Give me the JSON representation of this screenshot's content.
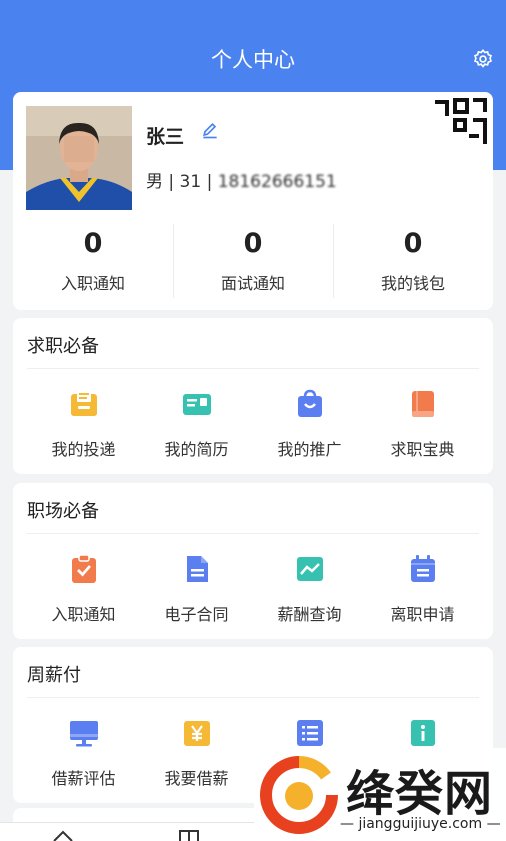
{
  "header": {
    "title": "个人中心",
    "settings_icon": "gear-icon"
  },
  "profile": {
    "name": "张三",
    "gender": "男",
    "age": "31",
    "phone": "18162666151",
    "stats": [
      {
        "value": "0",
        "label": "入职通知"
      },
      {
        "value": "0",
        "label": "面试通知"
      },
      {
        "value": "0",
        "label": "我的钱包"
      }
    ]
  },
  "sections": [
    {
      "title": "求职必备",
      "items": [
        {
          "label": "我的投递",
          "icon": "inbox-icon",
          "color": "#f5b936"
        },
        {
          "label": "我的简历",
          "icon": "id-card-icon",
          "color": "#36c1b0"
        },
        {
          "label": "我的推广",
          "icon": "shopping-bag-icon",
          "color": "#5b7ff0"
        },
        {
          "label": "求职宝典",
          "icon": "book-icon",
          "color": "#f27b4b"
        }
      ]
    },
    {
      "title": "职场必备",
      "items": [
        {
          "label": "入职通知",
          "icon": "clipboard-check-icon",
          "color": "#f27b4b"
        },
        {
          "label": "电子合同",
          "icon": "document-icon",
          "color": "#5b7ff0"
        },
        {
          "label": "薪酬查询",
          "icon": "chart-line-icon",
          "color": "#36c1b0"
        },
        {
          "label": "离职申请",
          "icon": "calendar-icon",
          "color": "#5b7ff0"
        }
      ]
    },
    {
      "title": "周薪付",
      "items": [
        {
          "label": "借薪评估",
          "icon": "monitor-icon",
          "color": "#5b7ff0"
        },
        {
          "label": "我要借薪",
          "icon": "yen-icon",
          "color": "#f5b936"
        },
        {
          "label": "",
          "icon": "list-icon",
          "color": "#5b7ff0"
        },
        {
          "label": "",
          "icon": "info-icon",
          "color": "#36c1b0"
        }
      ]
    }
  ],
  "watermark": {
    "text": "绛癸网",
    "url": "jiangguijiuye.com"
  }
}
